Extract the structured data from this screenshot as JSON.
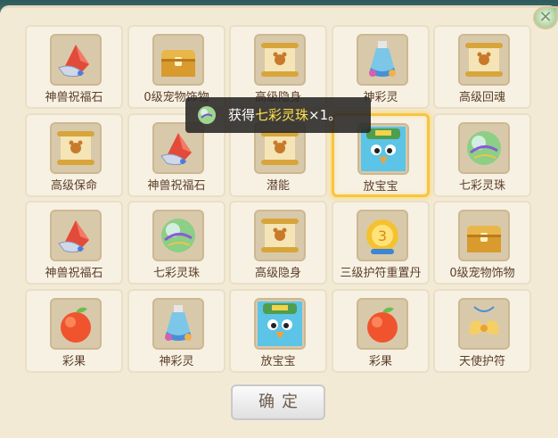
{
  "rewards": [
    {
      "label": "神兽祝福石",
      "icon": "crystal-icon",
      "selected": false
    },
    {
      "label": "0级宠物饰物",
      "icon": "chest-icon",
      "selected": false
    },
    {
      "label": "高级隐身",
      "icon": "scroll-icon",
      "selected": false
    },
    {
      "label": "神彩灵",
      "icon": "potion-icon",
      "selected": false
    },
    {
      "label": "高级回魂",
      "icon": "scroll-icon",
      "selected": false
    },
    {
      "label": "高级保命",
      "icon": "scroll-icon",
      "selected": false
    },
    {
      "label": "神兽祝福石",
      "icon": "crystal-icon",
      "selected": false
    },
    {
      "label": "潜能",
      "icon": "scroll-icon",
      "selected": false
    },
    {
      "label": "放宝宝",
      "icon": "bird-pet-icon",
      "selected": true
    },
    {
      "label": "七彩灵珠",
      "icon": "orb-icon",
      "selected": false
    },
    {
      "label": "神兽祝福石",
      "icon": "crystal-icon",
      "selected": false
    },
    {
      "label": "七彩灵珠",
      "icon": "orb-icon",
      "selected": false
    },
    {
      "label": "高级隐身",
      "icon": "scroll-icon",
      "selected": false
    },
    {
      "label": "三级护符重置丹",
      "icon": "coin-icon",
      "selected": false
    },
    {
      "label": "0级宠物饰物",
      "icon": "chest-icon",
      "selected": false
    },
    {
      "label": "彩果",
      "icon": "fruit-icon",
      "selected": false
    },
    {
      "label": "神彩灵",
      "icon": "potion-icon",
      "selected": false
    },
    {
      "label": "放宝宝",
      "icon": "bird-pet-icon",
      "selected": false
    },
    {
      "label": "彩果",
      "icon": "fruit-icon",
      "selected": false
    },
    {
      "label": "天使护符",
      "icon": "wing-amulet-icon",
      "selected": false
    }
  ],
  "toast": {
    "prefix": "获得",
    "item": "七彩灵珠",
    "suffix": "×1。",
    "icon": "orb-icon"
  },
  "confirm_label": "确定",
  "colors": {
    "gold_highlight": "#ffe14a",
    "selected_border": "#f5c542",
    "panel_bg": "#f3ead6"
  }
}
